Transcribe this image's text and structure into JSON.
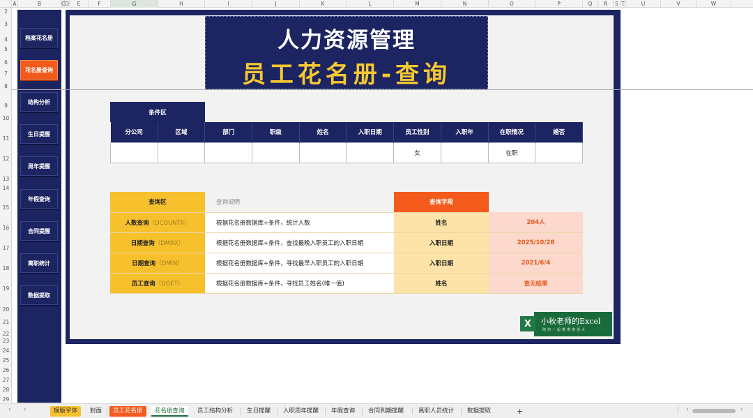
{
  "columns": [
    "A",
    "B",
    "C",
    "D",
    "E",
    "F",
    "G",
    "H",
    "I",
    "J",
    "K",
    "L",
    "M",
    "N",
    "O",
    "P",
    "Q",
    "R",
    "S",
    "T",
    "U",
    "V",
    "W"
  ],
  "rows": [
    "2",
    "3",
    "4",
    "5",
    "6",
    "7",
    "8",
    "9",
    "10",
    "11",
    "12",
    "13",
    "14",
    "15",
    "16",
    "17",
    "18",
    "19",
    "20",
    "21",
    "22",
    "23",
    "24",
    "25",
    "26",
    "27",
    "28",
    "29"
  ],
  "sidebar": {
    "items": [
      {
        "label": "档案花名册"
      },
      {
        "label": "花名册查询"
      },
      {
        "label": "结构分析"
      },
      {
        "label": "生日提醒"
      },
      {
        "label": "周年提醒"
      },
      {
        "label": "年假查询"
      },
      {
        "label": "合同提醒"
      },
      {
        "label": "离职统计"
      },
      {
        "label": "数据提取"
      }
    ]
  },
  "title": {
    "line1": "人力资源管理",
    "line2": "员工花名册-查询"
  },
  "condition": {
    "header": "条件区",
    "columns": [
      "分公司",
      "区域",
      "部门",
      "职级",
      "姓名",
      "入职日期",
      "员工性别",
      "入职年",
      "在职情况",
      "婚否"
    ],
    "values": [
      "",
      "",
      "",
      "",
      "",
      "",
      "女",
      "",
      "在职",
      ""
    ]
  },
  "query": {
    "header": "查询区",
    "desc_header": "查询说明",
    "field_header": "查询字段",
    "rows": [
      {
        "label": "人数查询",
        "fn": "（DCOUNTA）",
        "desc": "根据花名册数据库+条件，统计人数",
        "field": "姓名",
        "result": "204人"
      },
      {
        "label": "日期查询",
        "fn": "（DMAX）",
        "desc": "根据花名册数据库+条件，查找最晚入职员工的入职日期",
        "field": "入职日期",
        "result": "2025/10/28"
      },
      {
        "label": "日期查询",
        "fn": "（DMIN）",
        "desc": "根据花名册数据库+条件，寻找最早入职员工的入职日期",
        "field": "入职日期",
        "result": "2021/6/4"
      },
      {
        "label": "员工查询",
        "fn": "（DGET）",
        "desc": "根据花名册数据库+条件，寻找员工姓名(唯一值)",
        "field": "姓名",
        "result": "查无结果"
      }
    ]
  },
  "logo": {
    "line1": "小秋老师的Excel",
    "line2": "陪你一起慢慢变强大",
    "badge": "X"
  },
  "tabs": [
    "模版字体",
    "封面",
    "员工花名册",
    "花名册查询",
    "员工结构分析",
    "生日提醒",
    "入职周年提醒",
    "年假查询",
    "合同到期提醒",
    "离职人员统计",
    "数据提取"
  ],
  "tabbar": {
    "add": "+",
    "more": "⋮",
    "prev": "‹",
    "next": "›"
  }
}
